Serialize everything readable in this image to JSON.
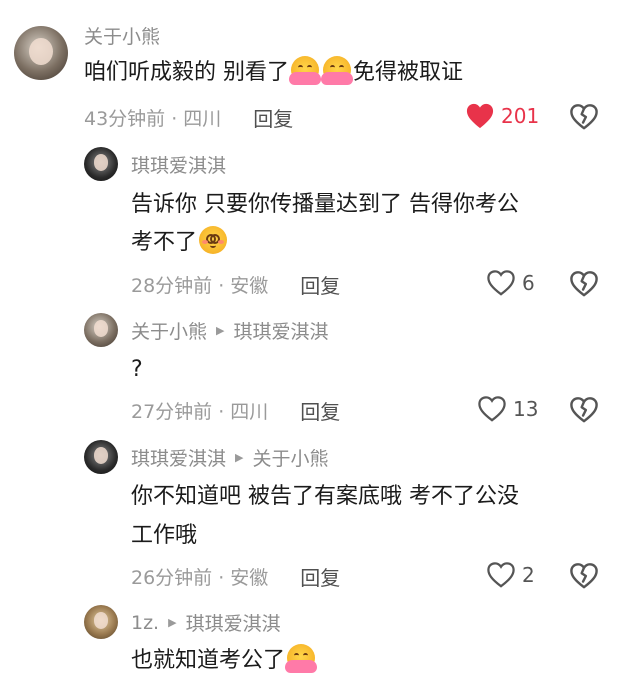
{
  "comments": [
    {
      "username": "关于小熊",
      "reply_to": "",
      "text_parts": [
        "咱们听成毅的 别看了",
        "免得被取证"
      ],
      "time_location": "43分钟前 · 四川",
      "reply_label": "回复",
      "likes": "201",
      "liked": true
    },
    {
      "username": "琪琪爱淇淇",
      "reply_to": "",
      "text_line1": "告诉你  只要你传播量达到了  告得你考公",
      "text_line2": "考不了",
      "time_location": "28分钟前 · 安徽",
      "reply_label": "回复",
      "likes": "6",
      "liked": false
    },
    {
      "username": "关于小熊",
      "reply_to": "琪琪爱淇淇",
      "text": "?",
      "time_location": "27分钟前 · 四川",
      "reply_label": "回复",
      "likes": "13",
      "liked": false
    },
    {
      "username": "琪琪爱淇淇",
      "reply_to": "关于小熊",
      "text_line1": "你不知道吧  被告了有案底哦  考不了公没",
      "text_line2": "工作哦",
      "time_location": "26分钟前 · 安徽",
      "reply_label": "回复",
      "likes": "2",
      "liked": false
    },
    {
      "username": "1z.",
      "reply_to": "琪琪爱淇淇",
      "text": "也就知道考公了",
      "time_location": "",
      "reply_label": "",
      "likes": "",
      "liked": false
    }
  ],
  "icons": {
    "like": "heart-icon",
    "dislike": "broken-heart-icon",
    "reply_arrow": "triangle-right-icon",
    "emoji_hug": "hugging-face-emoji",
    "emoji_blush": "smiling-face-emoji"
  },
  "colors": {
    "liked_heart": "#e8334a",
    "meta_text": "#9a9a9a",
    "username": "#8c8c8c"
  }
}
